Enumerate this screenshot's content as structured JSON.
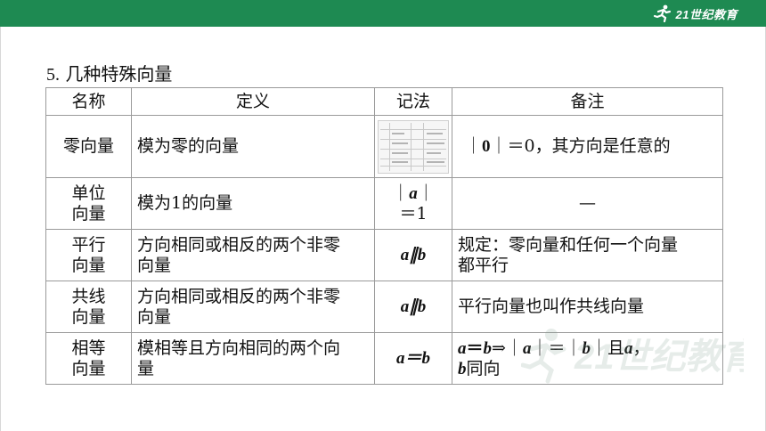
{
  "header": {
    "logo_text": "21世纪教育",
    "brand_color": "#1e8a52"
  },
  "section": {
    "number": "5.",
    "title": "几种特殊向量"
  },
  "table": {
    "headers": {
      "name": "名称",
      "definition": "定义",
      "notation": "记法",
      "note": "备注"
    },
    "rows": [
      {
        "name_1": "零向量",
        "name_2": "",
        "definition": "模为零的向量",
        "notation_kind": "thumbnail",
        "note_parts": [
          "｜",
          "0",
          "｜＝0，其方向是任意的"
        ]
      },
      {
        "name_1": "单位",
        "name_2": "向量",
        "definition": "模为1的向量",
        "notation_line1_pre": "｜",
        "notation_line1_var": "a",
        "notation_line1_post": "｜",
        "notation_line2": "＝1",
        "note": "—"
      },
      {
        "name_1": "平行",
        "name_2": "向量",
        "definition_1": "方向相同或相反的两个非零",
        "definition_2": "向量",
        "notation": "a∥b",
        "note_1": "规定：零向量和任何一个向量",
        "note_2": "都平行"
      },
      {
        "name_1": "共线",
        "name_2": "向量",
        "definition_1": "方向相同或相反的两个非零",
        "definition_2": "向量",
        "notation": "a∥b",
        "note": "平行向量也叫作共线向量"
      },
      {
        "name_1": "相等",
        "name_2": "向量",
        "definition_1": "模相等且方向相同的两个向",
        "definition_2": "量",
        "notation": "a＝b",
        "note_line1": [
          "a",
          "＝",
          "b",
          "⇒｜",
          "a",
          "｜＝｜",
          "b",
          "｜且",
          "a",
          "，"
        ],
        "note_line2": [
          "b",
          "同向"
        ]
      }
    ]
  },
  "watermark_text": "21世纪教育"
}
